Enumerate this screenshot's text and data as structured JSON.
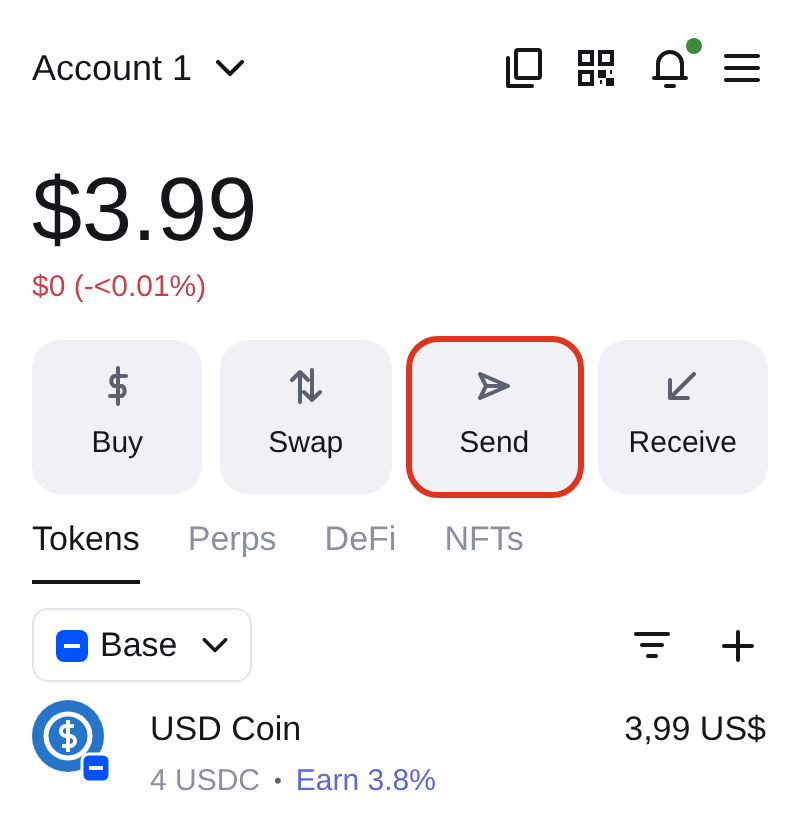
{
  "header": {
    "account": "Account 1",
    "notification_dot": true
  },
  "balance": {
    "amount": "$3.99",
    "change": "$0 (-<0.01%)"
  },
  "actions": [
    {
      "kind": "buy",
      "label": "Buy",
      "highlighted": false
    },
    {
      "kind": "swap",
      "label": "Swap",
      "highlighted": false
    },
    {
      "kind": "send",
      "label": "Send",
      "highlighted": true
    },
    {
      "kind": "receive",
      "label": "Receive",
      "highlighted": false
    }
  ],
  "tabs": [
    {
      "label": "Tokens",
      "selected": true
    },
    {
      "label": "Perps",
      "selected": false
    },
    {
      "label": "DeFi",
      "selected": false
    },
    {
      "label": "NFTs",
      "selected": false
    }
  ],
  "network_filter": {
    "label": "Base"
  },
  "tokens": [
    {
      "name": "USD Coin",
      "amount": "4 USDC",
      "separator": "•",
      "earn": "Earn 3.8%",
      "value": "3,99 US$"
    }
  ]
}
